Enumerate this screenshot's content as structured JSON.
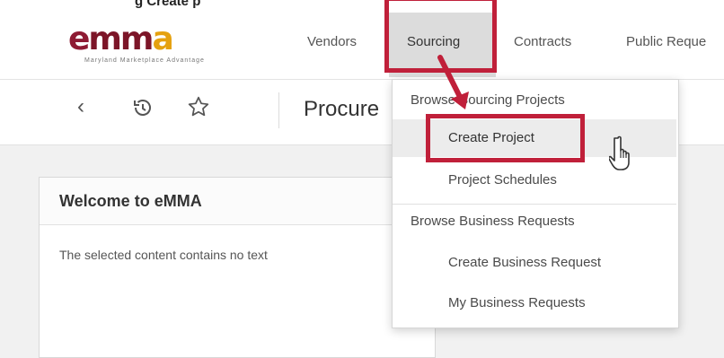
{
  "tip_text": "g   Create   p",
  "logo": {
    "e": "e",
    "mm": "mm",
    "a": "a",
    "tagline": "Maryland Marketplace Advantage"
  },
  "nav": {
    "vendors": "Vendors",
    "sourcing": "Sourcing",
    "contracts": "Contracts",
    "public_requests": "Public Reque"
  },
  "toolbar": {
    "back_icon": "chevron-left-icon",
    "history_icon": "history-icon",
    "favorite_icon": "star-icon",
    "page_title": "Procure"
  },
  "panel": {
    "title": "Welcome to eMMA",
    "body": "The selected content contains no text"
  },
  "dropdown": {
    "browse_sourcing": "Browse Sourcing Projects",
    "create_project": "Create Project",
    "project_schedules": "Project Schedules",
    "browse_business": "Browse Business Requests",
    "create_business": "Create Business Request",
    "my_business": "My Business Requests"
  },
  "highlight_color": "#c0203a"
}
